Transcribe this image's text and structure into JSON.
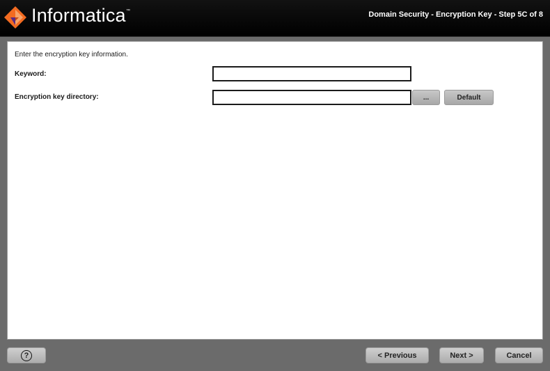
{
  "header": {
    "brand": "Informatica",
    "trademark": "™",
    "step_title": "Domain Security - Encryption Key - Step 5C of 8",
    "logo_icon": "informatica-diamond-logo",
    "colors": {
      "logo_orange": "#f26b21",
      "logo_purple": "#5b2c83",
      "header_bg": "#000000"
    }
  },
  "main": {
    "intro": "Enter the encryption key information.",
    "keyword": {
      "label": "Keyword:",
      "value": ""
    },
    "directory": {
      "label": "Encryption key directory:",
      "value": "",
      "browse_label": "...",
      "default_label": "Default"
    }
  },
  "footer": {
    "help_icon": "question-circle-icon",
    "help_symbol": "?",
    "previous_label": "< Previous",
    "next_label": "Next >",
    "cancel_label": "Cancel"
  }
}
